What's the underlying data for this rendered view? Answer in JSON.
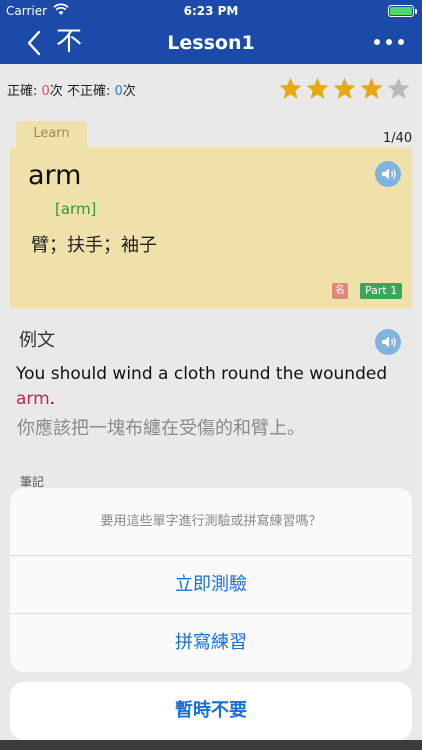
{
  "status_bar": {
    "carrier": "Carrier",
    "time": "6:23 PM",
    "battery_level": 1.0
  },
  "nav": {
    "title": "Lesson1",
    "no_label": "不"
  },
  "stats": {
    "correct_label": "正確: ",
    "correct_count": "0",
    "correct_unit": "次 ",
    "incorrect_label": "不正確: ",
    "incorrect_count": "0",
    "incorrect_unit": "次"
  },
  "rating": {
    "filled": 4,
    "total": 5,
    "filled_color": "#e6a913",
    "empty_color": "#b9b9b9"
  },
  "card": {
    "tab": "Learn",
    "counter": "1/40",
    "word": "arm",
    "phonetic": "[arm]",
    "meaning": "臂；扶手；袖子",
    "pos_badge": "名",
    "part_badge": "Part 1"
  },
  "example": {
    "title": "例文",
    "sentence_prefix": "You should wind a cloth round the wounded ",
    "sentence_highlight": "arm",
    "sentence_suffix": ".",
    "translation": "你應該把一塊布纏在受傷的和臂上。"
  },
  "notes": {
    "label": "筆記"
  },
  "action_sheet": {
    "message": "要用這些單字進行測驗或拼寫練習嗎？",
    "actions": [
      "立即測驗",
      "拼寫練習"
    ],
    "cancel": "暫時不要"
  },
  "colors": {
    "nav": "#1b4aa8",
    "card": "#f0e1ab",
    "action_blue": "#1a6fd6",
    "highlight": "#c0245a"
  }
}
